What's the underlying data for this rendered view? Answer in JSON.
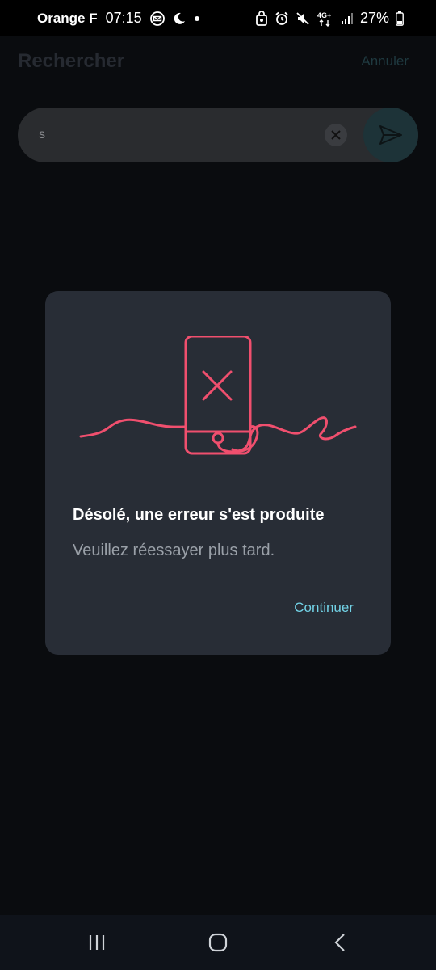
{
  "status_bar": {
    "carrier": "Orange F",
    "time": "07:15",
    "network": "4G+",
    "battery": "27%",
    "icons_left": [
      "mail-icon",
      "moon-icon",
      "dot-icon"
    ],
    "icons_right": [
      "lock-shield-icon",
      "alarm-icon",
      "mute-icon",
      "network-icon",
      "signal-icon",
      "battery-icon"
    ]
  },
  "header": {
    "title": "Rechercher",
    "cancel_label": "Annuler"
  },
  "search": {
    "value": "s",
    "clear_icon": "close-icon",
    "send_icon": "send-icon"
  },
  "dialog": {
    "illustration_icon": "phone-error-icon",
    "title": "Désolé, une erreur s'est produite",
    "message": "Veuillez réessayer plus tard.",
    "continue_label": "Continuer"
  },
  "colors": {
    "accent_pink": "#f04f6e",
    "accent_cyan": "#72d2e6",
    "dialog_bg": "#282d36"
  },
  "nav_bar": {
    "recent_icon": "recent-apps-icon",
    "home_icon": "home-icon",
    "back_icon": "back-icon"
  }
}
